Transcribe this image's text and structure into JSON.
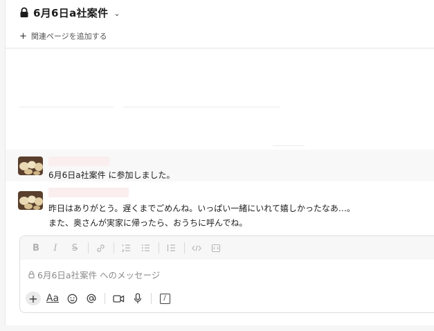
{
  "channel": {
    "title": "6月6日a社案件",
    "bookmark_label": "関連ページを追加する"
  },
  "messages": {
    "join_channel": "6月6日a社案件",
    "join_suffix": " に参加しました。",
    "line1": "昨日はありがとう。遅くまでごめんね。いっぱい一緒にいれて嬉しかったなあ…。",
    "line2": "また、奥さんが実家に帰ったら、おうちに呼んでね。"
  },
  "composer": {
    "placeholder": "6月6日a社案件 へのメッセージ",
    "format_buttons": [
      "B",
      "I",
      "S"
    ],
    "aa_label": "Aa"
  },
  "colors": {
    "avatar_bg": "#6b4f3a",
    "name_blur": "#fbeeee"
  }
}
